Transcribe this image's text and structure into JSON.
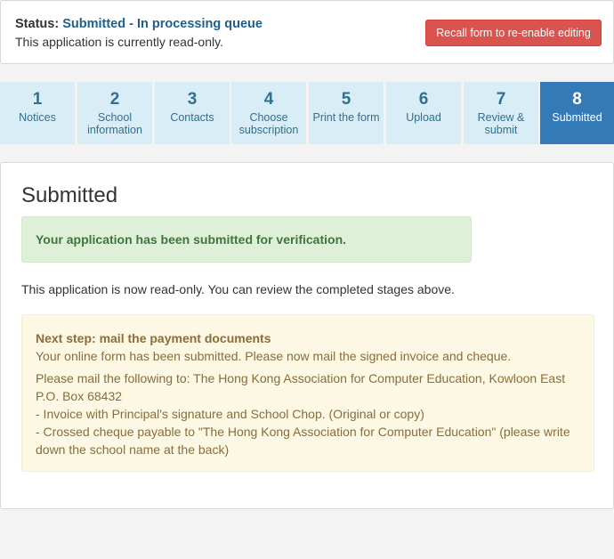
{
  "status": {
    "label": "Status:",
    "value": "Submitted - In processing queue",
    "subtitle": "This application is currently read-only.",
    "recall_button": "Recall form to re-enable editing"
  },
  "steps": [
    {
      "num": "1",
      "label": "Notices"
    },
    {
      "num": "2",
      "label": "School information"
    },
    {
      "num": "3",
      "label": "Contacts"
    },
    {
      "num": "4",
      "label": "Choose subscription"
    },
    {
      "num": "5",
      "label": "Print the form"
    },
    {
      "num": "6",
      "label": "Upload"
    },
    {
      "num": "7",
      "label": "Review & submit"
    },
    {
      "num": "8",
      "label": "Submitted"
    }
  ],
  "panel": {
    "title": "Submitted",
    "success_message": "Your application has been submitted for verification.",
    "readonly_note": "This application is now read-only. You can review the completed stages above.",
    "next_step": {
      "heading": "Next step: mail the payment documents",
      "line1": "Your online form has been submitted. Please now mail the signed invoice and cheque.",
      "line2": "Please mail the following to: The Hong Kong Association for Computer Education, Kowloon East P.O. Box 68432",
      "line3": "- Invoice with Principal's signature and School Chop. (Original or copy)",
      "line4": "- Crossed cheque payable to \"The Hong Kong Association for Computer Education\" (please write down the school name at the back)"
    }
  },
  "colors": {
    "status_value": "#1f5f8b",
    "danger": "#d9534f",
    "step_bg": "#d9edf7",
    "step_active": "#337ab7",
    "success_bg": "#dff0d8",
    "warning_bg": "#fcf8e3"
  }
}
